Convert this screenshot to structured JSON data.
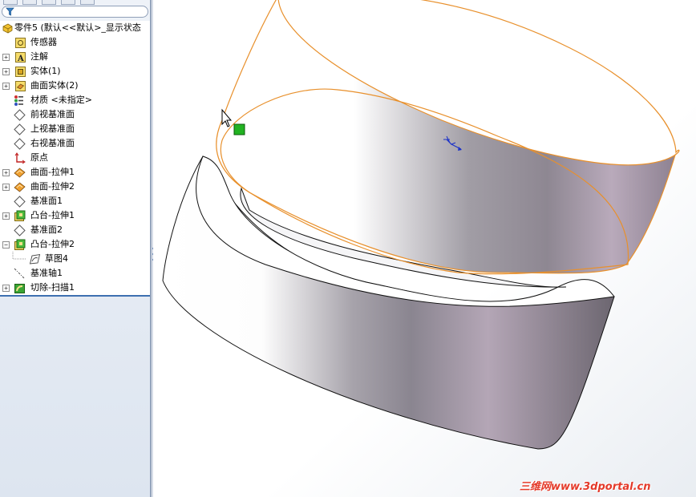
{
  "feature_tree": {
    "filter_placeholder": "",
    "root_label": "零件5  (默认<<默认>_显示状态",
    "items": [
      {
        "label": "传感器",
        "icon": "sensor-icon",
        "expandable": false
      },
      {
        "label": "注解",
        "icon": "annotation-icon",
        "expandable": true
      },
      {
        "label": "实体(1)",
        "icon": "solid-bodies-icon",
        "expandable": true
      },
      {
        "label": "曲面实体(2)",
        "icon": "surface-bodies-icon",
        "expandable": true
      },
      {
        "label": "材质 <未指定>",
        "icon": "material-icon",
        "expandable": false
      },
      {
        "label": "前视基准面",
        "icon": "plane-icon",
        "expandable": false
      },
      {
        "label": "上视基准面",
        "icon": "plane-icon",
        "expandable": false
      },
      {
        "label": "右视基准面",
        "icon": "plane-icon",
        "expandable": false
      },
      {
        "label": "原点",
        "icon": "origin-icon",
        "expandable": false
      },
      {
        "label": "曲面-拉伸1",
        "icon": "surface-extrude-icon",
        "expandable": true
      },
      {
        "label": "曲面-拉伸2",
        "icon": "surface-extrude-icon",
        "expandable": true
      },
      {
        "label": "基准面1",
        "icon": "plane-icon",
        "expandable": false
      },
      {
        "label": "凸台-拉伸1",
        "icon": "boss-extrude-icon",
        "expandable": true
      },
      {
        "label": "基准面2",
        "icon": "plane-icon",
        "expandable": false
      },
      {
        "label": "凸台-拉伸2",
        "icon": "boss-extrude-icon",
        "expandable": true,
        "expanded": true
      },
      {
        "label": "草图4",
        "icon": "sketch-icon",
        "expandable": false,
        "child": true
      },
      {
        "label": "基准轴1",
        "icon": "axis-icon",
        "expandable": false
      },
      {
        "label": "切除-扫描1",
        "icon": "cut-sweep-icon",
        "expandable": true
      }
    ]
  },
  "watermark": "三维网www.3dportal.cn",
  "colors": {
    "selection_edge": "#e8902c",
    "tree_separator": "#3d6fb0",
    "handle_green": "#22b322"
  }
}
